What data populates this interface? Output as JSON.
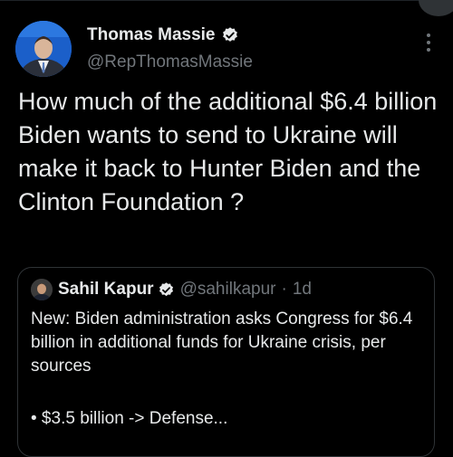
{
  "tweet": {
    "author_name": "Thomas Massie",
    "author_handle": "@RepThomasMassie",
    "text": "How much of the additional $6.4 billion Biden wants to send to Ukraine will make it back to Hunter Biden and the Clinton Foundation ?",
    "verified_icon": "verified-badge-icon",
    "more_icon": "more-options-icon"
  },
  "quote": {
    "author_name": "Sahil Kapur",
    "author_handle": "@sahilkapur",
    "separator": "·",
    "time": "1d",
    "text": "New: Biden administration asks Congress for $6.4 billion in additional funds for Ukraine crisis, per sources",
    "bullet": "• $3.5 billion -> Defense..."
  },
  "colors": {
    "background": "#000000",
    "primary_text": "#e7e9ea",
    "secondary_text": "#71767b",
    "border": "#2f3336",
    "verified_badge": "#e7e9ea"
  }
}
